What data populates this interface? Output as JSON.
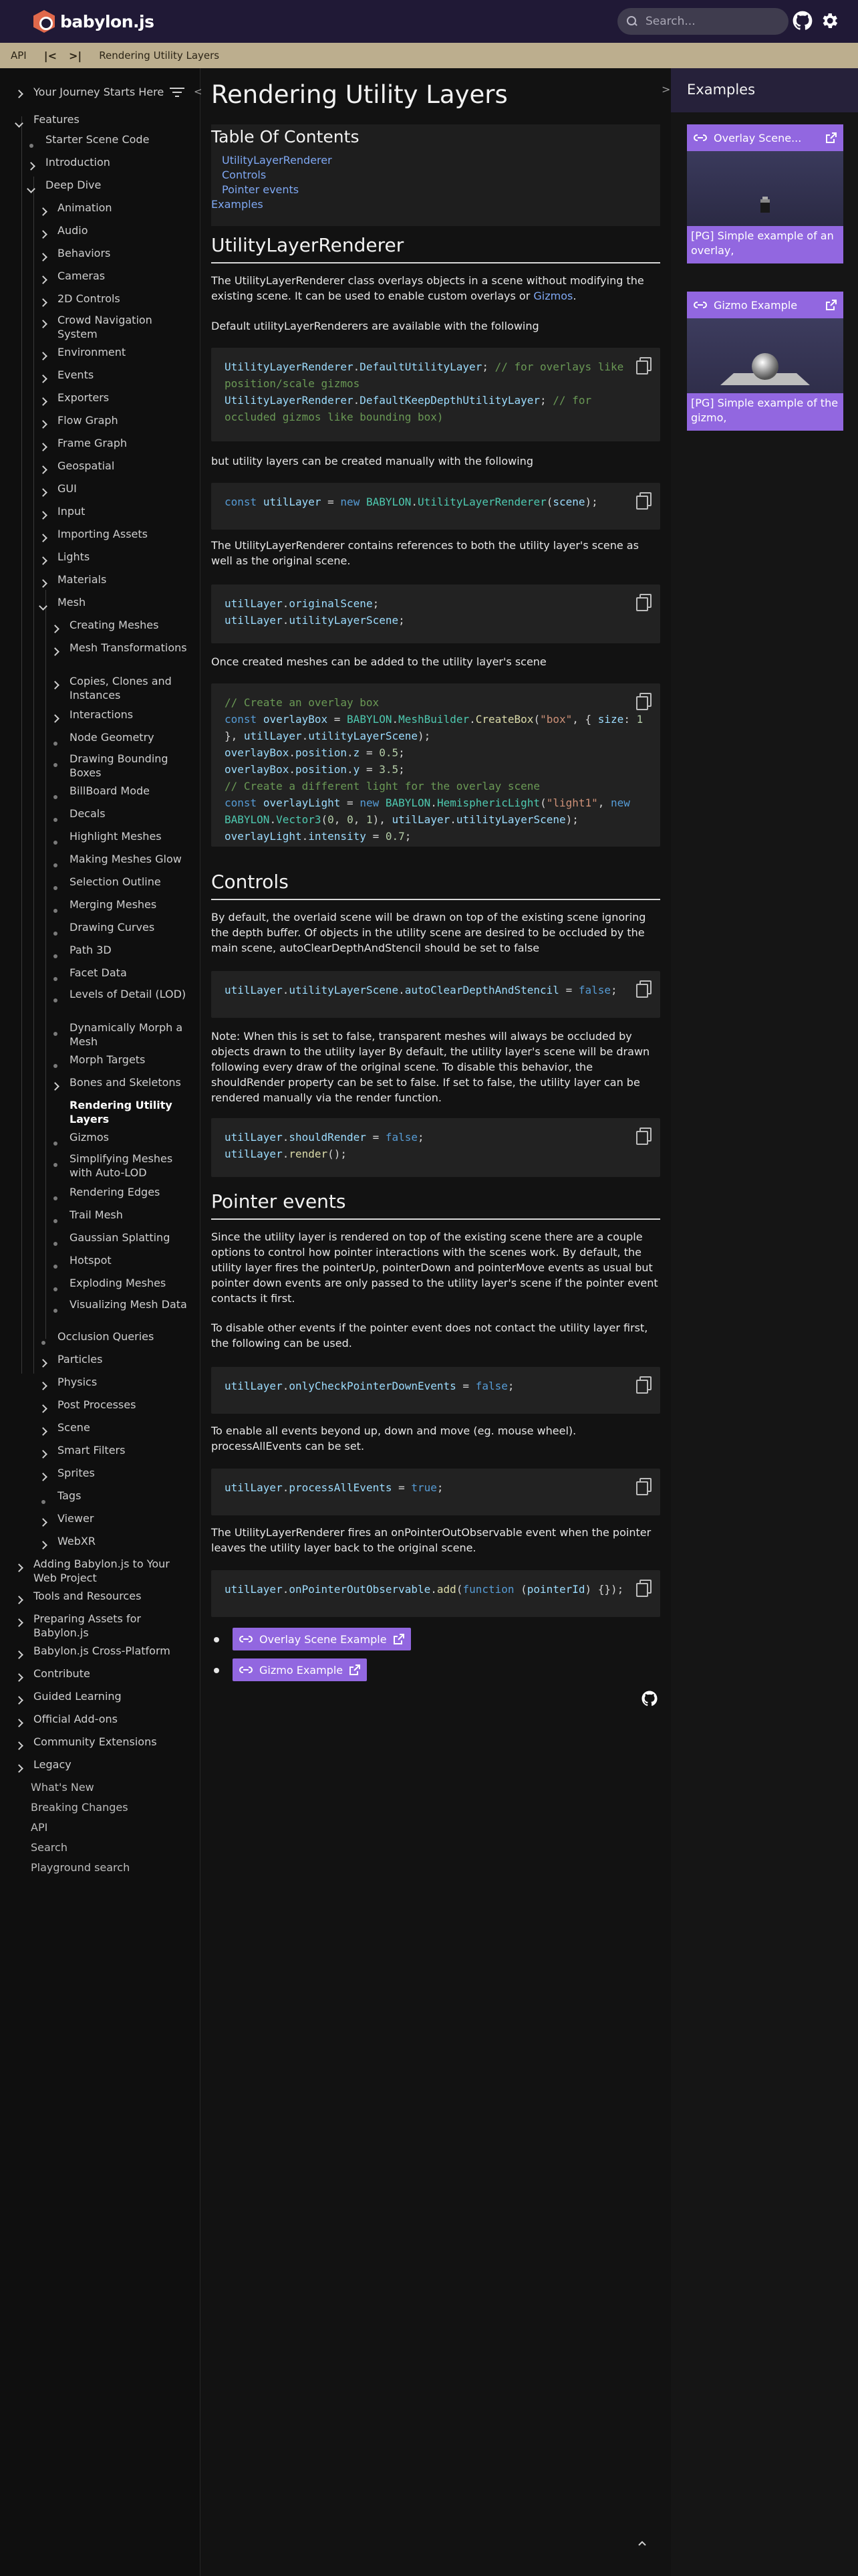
{
  "header": {
    "logo_text": "babylon.js",
    "search_placeholder": "Search...",
    "icons": [
      "github-icon",
      "gear-icon"
    ]
  },
  "subbar": {
    "api": "API",
    "prev": "|<",
    "next": ">|",
    "crumb": "Rendering Utility Layers"
  },
  "sidebar": {
    "head_label": "Your Journey Starts Here",
    "items": [
      {
        "label": "Features"
      },
      {
        "label": "Starter Scene Code"
      },
      {
        "label": "Introduction"
      },
      {
        "label": "Deep Dive"
      },
      {
        "label": "Animation"
      },
      {
        "label": "Audio"
      },
      {
        "label": "Behaviors"
      },
      {
        "label": "Cameras"
      },
      {
        "label": "2D Controls"
      },
      {
        "label": "Crowd Navigation System"
      },
      {
        "label": "Environment"
      },
      {
        "label": "Events"
      },
      {
        "label": "Exporters"
      },
      {
        "label": "Flow Graph"
      },
      {
        "label": "Frame Graph"
      },
      {
        "label": "Geospatial"
      },
      {
        "label": "GUI"
      },
      {
        "label": "Input"
      },
      {
        "label": "Importing Assets"
      },
      {
        "label": "Lights"
      },
      {
        "label": "Materials"
      },
      {
        "label": "Mesh"
      },
      {
        "label": "Creating Meshes"
      },
      {
        "label": "Mesh Transformations"
      },
      {
        "label": "Copies, Clones and Instances"
      },
      {
        "label": "Interactions"
      },
      {
        "label": "Node Geometry"
      },
      {
        "label": "Drawing Bounding Boxes"
      },
      {
        "label": "BillBoard Mode"
      },
      {
        "label": "Decals"
      },
      {
        "label": "Highlight Meshes"
      },
      {
        "label": "Making Meshes Glow"
      },
      {
        "label": "Selection Outline"
      },
      {
        "label": "Merging Meshes"
      },
      {
        "label": "Drawing Curves"
      },
      {
        "label": "Path 3D"
      },
      {
        "label": "Facet Data"
      },
      {
        "label": "Levels of Detail (LOD)"
      },
      {
        "label": "Dynamically Morph a Mesh"
      },
      {
        "label": "Morph Targets"
      },
      {
        "label": "Bones and Skeletons"
      },
      {
        "label": "Rendering Utility Layers"
      },
      {
        "label": "Gizmos"
      },
      {
        "label": "Simplifying Meshes with Auto-LOD"
      },
      {
        "label": "Rendering Edges"
      },
      {
        "label": "Trail Mesh"
      },
      {
        "label": "Gaussian Splatting"
      },
      {
        "label": "Hotspot"
      },
      {
        "label": "Exploding Meshes"
      },
      {
        "label": "Visualizing Mesh Data"
      },
      {
        "label": "Occlusion Queries"
      },
      {
        "label": "Particles"
      },
      {
        "label": "Physics"
      },
      {
        "label": "Post Processes"
      },
      {
        "label": "Scene"
      },
      {
        "label": "Smart Filters"
      },
      {
        "label": "Sprites"
      },
      {
        "label": "Tags"
      },
      {
        "label": "Viewer"
      },
      {
        "label": "WebXR"
      },
      {
        "label": "Adding Babylon.js to Your Web Project"
      },
      {
        "label": "Tools and Resources"
      },
      {
        "label": "Preparing Assets for Babylon.js"
      },
      {
        "label": "Babylon.js Cross-Platform"
      },
      {
        "label": "Contribute"
      },
      {
        "label": "Guided Learning"
      },
      {
        "label": "Official Add-ons"
      },
      {
        "label": "Community Extensions"
      },
      {
        "label": "Legacy"
      },
      {
        "label": "What's New"
      },
      {
        "label": "Breaking Changes"
      },
      {
        "label": "API"
      },
      {
        "label": "Search"
      },
      {
        "label": "Playground search"
      }
    ]
  },
  "main": {
    "title": "Rendering Utility Layers",
    "toc": {
      "heading": "Table Of Contents",
      "links": [
        "UtilityLayerRenderer",
        "Controls",
        "Pointer events",
        "Examples"
      ]
    },
    "sections": {
      "utility": {
        "heading": "UtilityLayerRenderer",
        "p1": "The UtilityLayerRenderer class overlays objects in a scene without modifying the existing scene. It can be used to enable custom overlays or ",
        "p1_link": "Gizmos",
        "p1_end": ".",
        "p2": "Default utilityLayerRenderers are available with the following",
        "p3": "but utility layers can be created manually with the following",
        "p4": "The UtilityLayerRenderer contains references to both the utility layer's scene as well as the original scene.",
        "p5": "Once created meshes can be added to the utility layer's scene"
      },
      "controls": {
        "heading": "Controls",
        "p1": "By default, the overlaid scene will be drawn on top of the existing scene ignoring the depth buffer. Of objects in the utility scene are desired to be occluded by the main scene, autoClearDepthAndStencil should be set to false",
        "p2": "Note: When this is set to false, transparent meshes will always be occluded by objects drawn to the utility layer By default, the utility layer's scene will be drawn following every draw of the original scene. To disable this behavior, the shouldRender property can be set to false. If set to false, the utility layer can be rendered manually via the render function."
      },
      "pointer": {
        "heading": "Pointer events",
        "p1": "Since the utility layer is rendered on top of the existing scene there are a couple options to control how pointer interactions with the scenes work. By default, the utility layer fires the pointerUp, pointerDown and pointerMove events as usual but pointer down events are only passed to the utility layer's scene if the pointer event contacts it first.",
        "p2": "To disable other events if the pointer event does not contact the utility layer first, the following can be used.",
        "p3": "To enable all events beyond up, down and move (eg. mouse wheel). processAllEvents can be set.",
        "p4": "The UtilityLayerRenderer fires an onPointerOutObservable event when the pointer leaves the utility layer back to the original scene."
      }
    },
    "example_buttons": [
      "Overlay Scene Example",
      "Gizmo Example"
    ]
  },
  "right_panel": {
    "title": "Examples",
    "cards": [
      {
        "title": "Overlay Scene...",
        "desc": "[PG] Simple example of an overlay,"
      },
      {
        "title": "Gizmo Example",
        "desc": "[PG] Simple example of the gizmo,"
      }
    ]
  },
  "colors": {
    "topbar": "#201936",
    "subbar": "#bcae8e",
    "accent": "#9267e0",
    "link": "#7fa8f3"
  }
}
